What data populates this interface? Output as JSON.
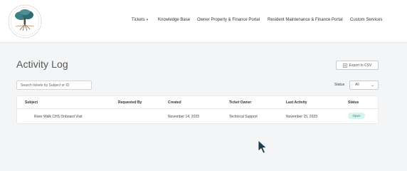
{
  "nav": {
    "tickets": "Tickets",
    "knowledge_base": "Knowledge Base",
    "owner_portal": "Owner Property & Finance Portal",
    "resident_portal": "Resident Maintenance & Finance Portal",
    "custom_services": "Custom Services"
  },
  "page": {
    "title": "Activity Log",
    "export_label": "Export to CSV"
  },
  "filters": {
    "search_placeholder": "Search tickets by Subject or ID",
    "search_value": "",
    "status_label": "Status",
    "status_value": "All"
  },
  "table": {
    "headers": {
      "subject": "Subject",
      "requested_by": "Requested By",
      "created": "Created",
      "ticket_owner": "Ticket Owner",
      "last_activity": "Last Activity",
      "status": "Status"
    },
    "rows": [
      {
        "subject": "River Walk CHS Onboard Visit",
        "requested_by": "",
        "created": "November 14, 2023",
        "ticket_owner": "Technical Support",
        "last_activity": "November 15, 2023",
        "status": "Open"
      }
    ]
  },
  "colors": {
    "status_open_bg": "#d6f3ee",
    "status_open_text": "#2f8a78"
  },
  "icons": {
    "logo": "tree-logo",
    "export": "download-icon",
    "dropdown": "chevron-down-icon",
    "cursor": "mouse-pointer-icon"
  }
}
